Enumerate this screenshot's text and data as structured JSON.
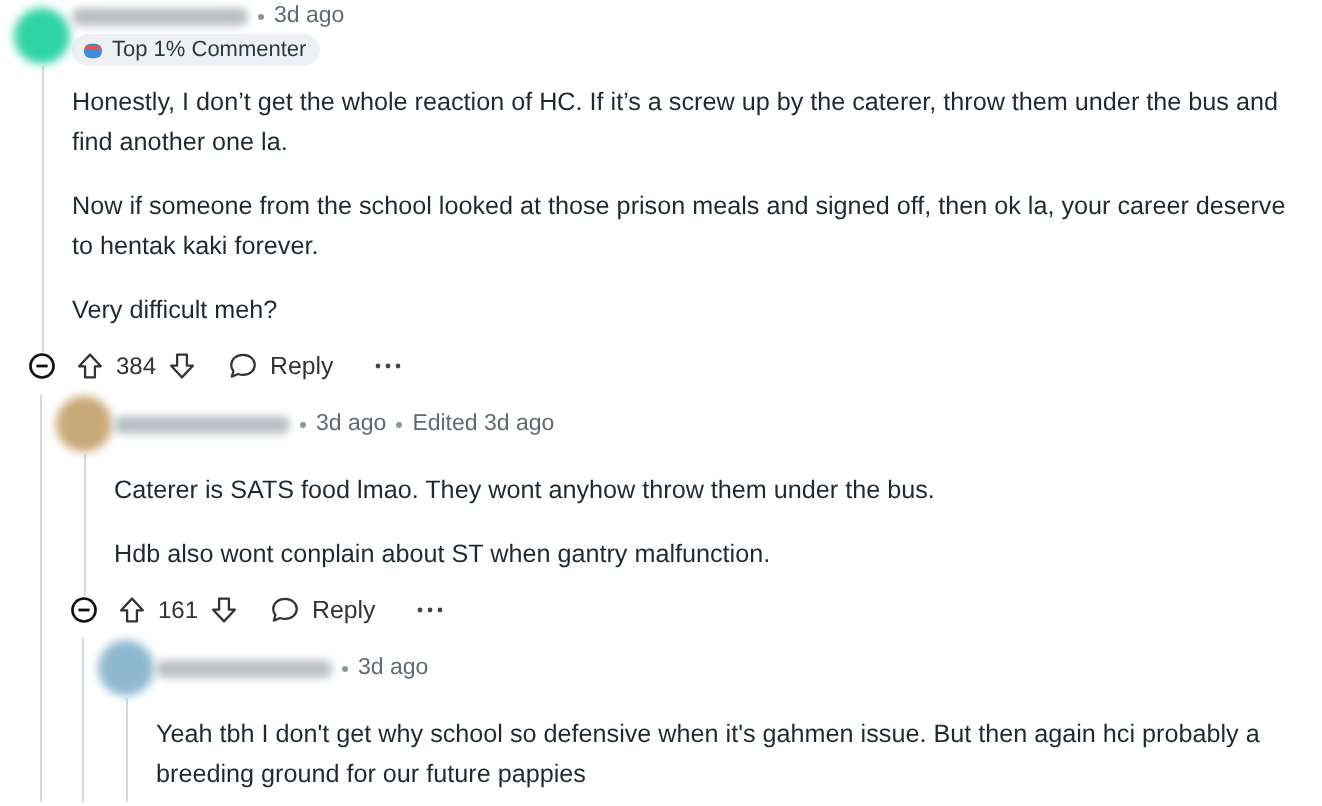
{
  "comments": [
    {
      "color": "#2fd4a4",
      "time": "3d ago",
      "badge": "Top 1% Commenter",
      "paragraphs": [
        "Honestly, I don’t get the whole reaction of HC. If it’s a screw up by the caterer, throw them under the bus and find another one la.",
        "Now if someone from the school looked at those prison meals and signed off, then ok la, your career deserve to hentak kaki forever.",
        "Very difficult meh?"
      ],
      "score": "384",
      "reply": "Reply",
      "expanded": true,
      "children": [
        {
          "color": "#c9a878",
          "time": "3d ago",
          "edited": "Edited 3d ago",
          "paragraphs": [
            "Caterer is SATS food lmao. They wont anyhow throw them under the bus.",
            "Hdb also wont conplain about ST when gantry malfunction."
          ],
          "score": "161",
          "reply": "Reply",
          "expanded": true,
          "children": [
            {
              "color": "#8fb8d0",
              "time": "3d ago",
              "paragraphs": [
                "Yeah tbh I don't get why school so defensive when it's gahmen issue. But then again hci probably a breeding ground for our future pappies"
              ]
            }
          ]
        }
      ]
    }
  ]
}
